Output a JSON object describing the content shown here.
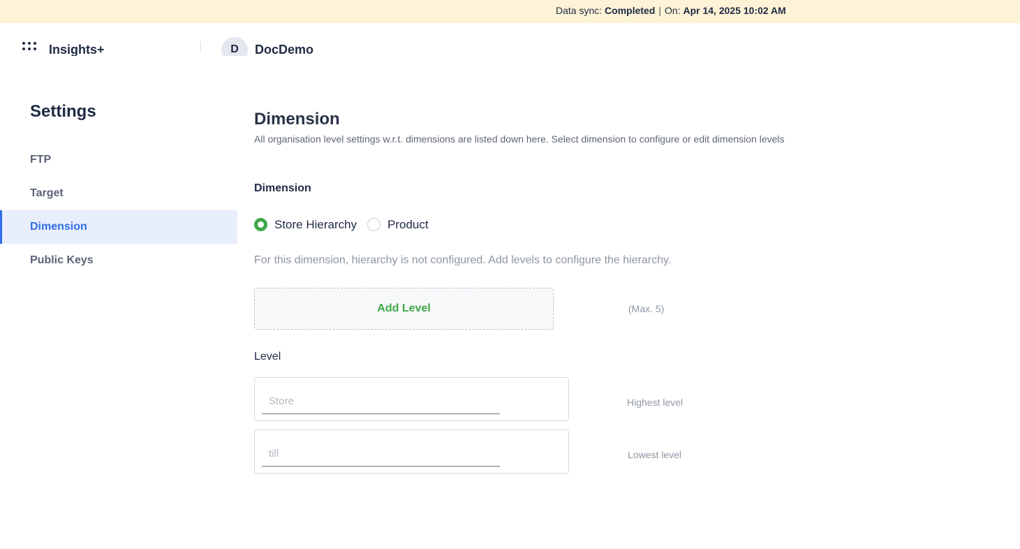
{
  "sync_bar": {
    "label": "Data sync:",
    "status": "Completed",
    "on_label": "On:",
    "timestamp": "Apr 14, 2025 10:02 AM"
  },
  "topbar": {
    "app_name": "Insights+",
    "org_initial": "D",
    "org_name": "DocDemo"
  },
  "sidebar": {
    "title": "Settings",
    "items": [
      {
        "label": "FTP",
        "active": false
      },
      {
        "label": "Target",
        "active": false
      },
      {
        "label": "Dimension",
        "active": true
      },
      {
        "label": "Public Keys",
        "active": false
      }
    ]
  },
  "main": {
    "title": "Dimension",
    "description": "All organisation level settings w.r.t. dimensions are listed down here. Select dimension to configure or edit dimension levels",
    "section_label": "Dimension",
    "radio_options": [
      {
        "label": "Store Hierarchy",
        "checked": true
      },
      {
        "label": "Product",
        "checked": false
      }
    ],
    "hint": "For this dimension, hierarchy is not configured. Add levels to configure the hierarchy.",
    "add_level_label": "Add Level",
    "max_note": "(Max. 5)",
    "level_label": "Level",
    "levels": [
      {
        "placeholder": "Store",
        "note": "Highest level"
      },
      {
        "placeholder": "till",
        "note": "Lowest level"
      }
    ]
  },
  "colors": {
    "sync_bar_bg": "#fdf3d6",
    "accent_blue": "#2f6de0",
    "accent_green": "#3ea84a",
    "active_nav_bg": "#e8eefc"
  },
  "icons": {
    "apps": "apps-grid-icon",
    "radio": "radio-icon"
  }
}
